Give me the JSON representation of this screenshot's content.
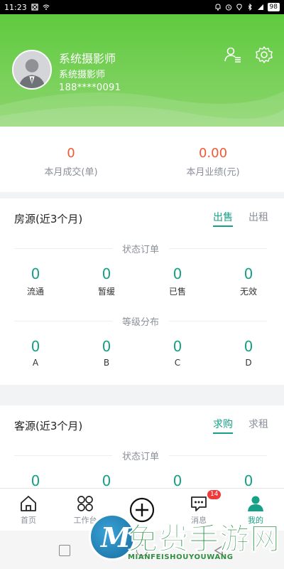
{
  "status_bar": {
    "time": "11:23",
    "battery": "98"
  },
  "profile": {
    "name": "系统摄影师",
    "role": "系统摄影师",
    "phone": "188****0091"
  },
  "stats": [
    {
      "value": "0",
      "label": "本月成交(单)"
    },
    {
      "value": "0.00",
      "label": "本月业绩(元)"
    }
  ],
  "house": {
    "title": "房源(近3个月)",
    "tabs": [
      "出售",
      "出租"
    ],
    "active_tab": "出售",
    "status_label": "状态订单",
    "status_items": [
      {
        "value": "0",
        "label": "流通"
      },
      {
        "value": "0",
        "label": "暂缓"
      },
      {
        "value": "0",
        "label": "已售"
      },
      {
        "value": "0",
        "label": "无效"
      }
    ],
    "level_label": "等级分布",
    "level_items": [
      {
        "value": "0",
        "label": "A"
      },
      {
        "value": "0",
        "label": "B"
      },
      {
        "value": "0",
        "label": "C"
      },
      {
        "value": "0",
        "label": "D"
      }
    ]
  },
  "client": {
    "title": "客源(近3个月)",
    "tabs": [
      "求购",
      "求租"
    ],
    "active_tab": "求购",
    "status_label": "状态订单",
    "status_items": [
      {
        "value": "0"
      },
      {
        "value": "0"
      },
      {
        "value": "0"
      },
      {
        "value": "0"
      }
    ]
  },
  "tabbar": {
    "items": [
      {
        "label": "首页",
        "icon": "home-icon"
      },
      {
        "label": "工作台",
        "icon": "workbench-icon"
      },
      {
        "label": "",
        "icon": "plus-circle-icon"
      },
      {
        "label": "消息",
        "icon": "message-icon",
        "badge": "14"
      },
      {
        "label": "我的",
        "icon": "profile-icon"
      }
    ],
    "active": "我的"
  },
  "watermark": {
    "logo_letter": "M",
    "text_cn": "免费手游网",
    "text_en": "MIANFEISHOUYOUWANG"
  },
  "colors": {
    "header_green": "#5fca3f",
    "accent_teal": "#16a085",
    "stat_orange": "#ee5a36",
    "badge_red": "#f03a3a"
  }
}
